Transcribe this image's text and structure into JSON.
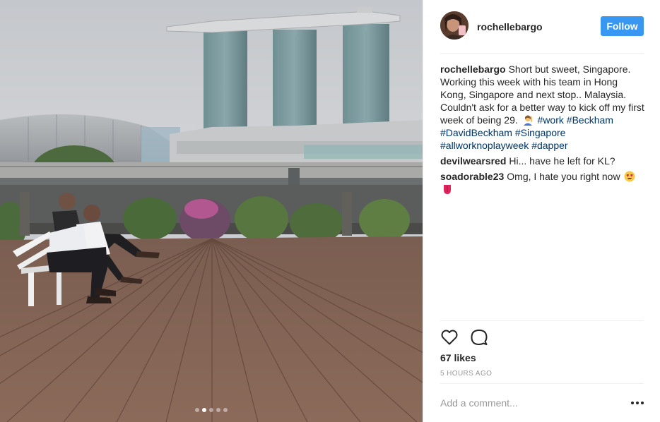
{
  "post": {
    "author": "rochellebargo",
    "follow_label": "Follow",
    "photo": {
      "description_icon": "photo-image",
      "carousel": {
        "count": 5,
        "active_index": 1
      }
    }
  },
  "caption": {
    "user": "rochellebargo",
    "text": "Short but sweet, Singapore. Working this week with his team in Hong Kong, Singapore and next stop.. Malaysia. Couldn't ask for a better way to kick off my first week of being 29.",
    "emoji": "woman-raising-hand-emoji",
    "hashtags": [
      "#work",
      "#Beckham",
      "#DavidBeckham",
      "#Singapore",
      "#allworknoplayweek",
      "#dapper"
    ]
  },
  "comments": [
    {
      "user": "devilwearsred",
      "text": "Hi... have he left for KL?"
    },
    {
      "user": "soadorable23",
      "text": "Omg, I hate you right now",
      "emojis": [
        "heart-eyes-emoji",
        "tongue-emoji"
      ]
    }
  ],
  "actions": {
    "like_icon": "heart-icon",
    "comment_icon": "speech-bubble-icon"
  },
  "likes_text": "67 likes",
  "time_text": "5 HOURS AGO",
  "add_comment": {
    "placeholder": "Add a comment..."
  },
  "more_icon": "more-options-icon",
  "colors": {
    "accent": "#3897f0",
    "hashtag": "#003569",
    "muted": "#999999",
    "text": "#262626",
    "separator": "#efefef"
  }
}
